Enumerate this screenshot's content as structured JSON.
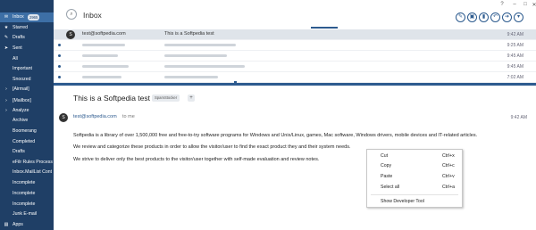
{
  "window": {
    "help": "?",
    "minimize": "–",
    "maximize": "□",
    "close": "✕"
  },
  "sidebar": {
    "items": [
      {
        "label": "Inbox",
        "badge": "2965",
        "icon": "inbox-icon",
        "glyph": "✉",
        "selected": true
      },
      {
        "label": "Starred",
        "icon": "star-icon",
        "glyph": "★"
      },
      {
        "label": "Drafts",
        "icon": "drafts-icon",
        "glyph": "✎"
      },
      {
        "label": "Sent",
        "icon": "sent-icon",
        "glyph": "➤"
      },
      {
        "label": "All"
      },
      {
        "label": "Important"
      },
      {
        "label": "Snoozed"
      },
      {
        "label": "[Airmail]",
        "icon": "folder-icon",
        "glyph": "›"
      },
      {
        "label": "[Mailbox]",
        "icon": "folder-icon",
        "glyph": "›"
      },
      {
        "label": "Analyze",
        "icon": "folder-icon",
        "glyph": "›"
      },
      {
        "label": "Archive"
      },
      {
        "label": "Boomerang"
      },
      {
        "label": "Completed"
      },
      {
        "label": "Drafts"
      },
      {
        "label": "eFilr Rules Process"
      },
      {
        "label": "Inbox.MailList Cont"
      },
      {
        "label": "Incomplete"
      },
      {
        "label": "Incomplete"
      },
      {
        "label": "Incomplete"
      },
      {
        "label": "Junk E-mail"
      },
      {
        "label": "Apps",
        "icon": "apps-icon",
        "glyph": "▤"
      }
    ]
  },
  "header": {
    "title": "Inbox"
  },
  "messages": [
    {
      "from": "test@softpedia.com",
      "subject": "This is a Softpedia test",
      "time": "9:42 AM",
      "selected": true
    },
    {
      "time": "9:25 AM"
    },
    {
      "time": "9:45 AM"
    },
    {
      "time": "9:45 AM"
    },
    {
      "time": "7:02 AM"
    }
  ],
  "reader": {
    "subject": "This is a Softpedia test",
    "tag": "SpamStocker",
    "tag_add": "+",
    "avatar": "S",
    "from": "test@softpedia.com",
    "to": "to me",
    "time": "9:42 AM",
    "body": [
      "Softpedia is a library of over 1,500,000 free and free-to-try software programs for Windows and Unix/Linux, games, Mac software, Windows drivers, mobile devices and IT-related articles.",
      "We review and categorize these products in order to allow the visitor/user to find the exact product they and their system needs.",
      "We strive to deliver only the best products to the visitor/user together with self-made evaluation and review notes."
    ]
  },
  "context_menu": {
    "items": [
      {
        "label": "Cut",
        "shortcut": "Ctrl+x"
      },
      {
        "label": "Copy",
        "shortcut": "Ctrl+c"
      },
      {
        "label": "Paste",
        "shortcut": "Ctrl+v"
      },
      {
        "label": "Select all",
        "shortcut": "Ctrl+a"
      },
      {
        "label": "Show Developer Tool",
        "shortcut": ""
      }
    ]
  },
  "colors": {
    "sidebar": "#1f3f66",
    "sidebar_selected": "#3d6fa6",
    "accent": "#2d5b8f"
  }
}
